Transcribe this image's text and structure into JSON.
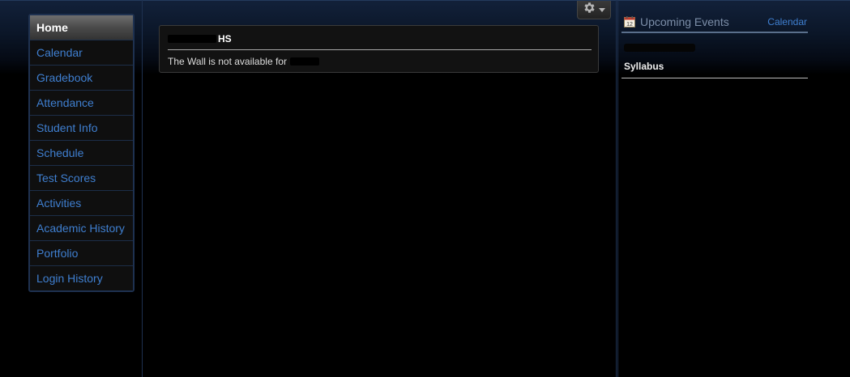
{
  "sidebar": {
    "items": [
      {
        "label": "Home",
        "active": true
      },
      {
        "label": "Calendar"
      },
      {
        "label": "Gradebook"
      },
      {
        "label": "Attendance"
      },
      {
        "label": "Student Info"
      },
      {
        "label": "Schedule"
      },
      {
        "label": "Test Scores"
      },
      {
        "label": "Activities"
      },
      {
        "label": "Academic History"
      },
      {
        "label": "Portfolio"
      },
      {
        "label": "Login History"
      }
    ]
  },
  "toolbar": {
    "gear_icon": "gear-icon",
    "dropdown_icon": "caret-down-icon"
  },
  "wall": {
    "school_suffix": "HS",
    "message": "The Wall is not available for"
  },
  "events": {
    "title": "Upcoming Events",
    "calendar_link": "Calendar",
    "calendar_icon": "calendar-icon",
    "items": [
      {
        "label": "Syllabus"
      }
    ]
  },
  "colors": {
    "link": "#3f7fd0",
    "active_bg": "#4a4a4a",
    "border_accent": "#1e3150"
  }
}
